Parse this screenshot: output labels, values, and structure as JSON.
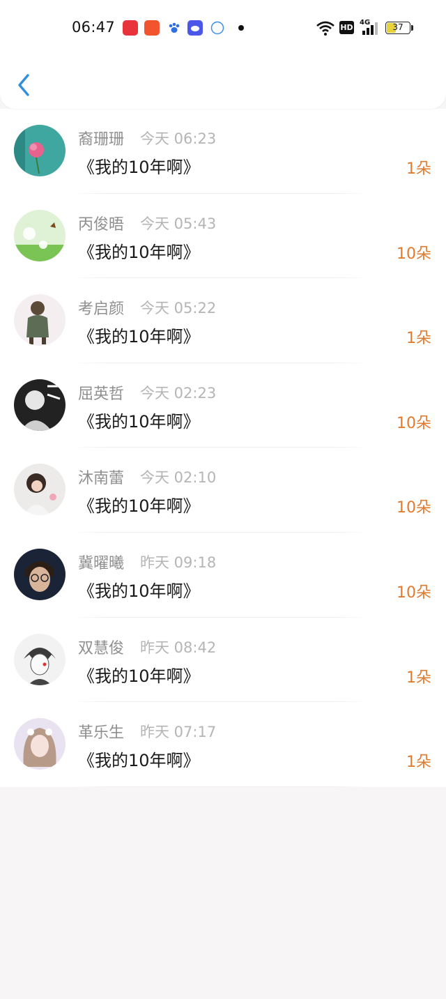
{
  "status_bar": {
    "time": "06:47",
    "hd": "HD",
    "network": "4G",
    "battery": "37"
  },
  "header": {
    "back_icon": "chevron-left-icon",
    "accent_color": "#2f8fdc"
  },
  "colors": {
    "count": "#e27a2e",
    "name": "#8f8f8f",
    "time": "#b5b5b5"
  },
  "items": [
    {
      "name": "裔珊珊",
      "time": "今天 06:23",
      "title": "《我的10年啊》",
      "count": "1朵"
    },
    {
      "name": "丙俊晤",
      "time": "今天 05:43",
      "title": "《我的10年啊》",
      "count": "10朵"
    },
    {
      "name": "考启颜",
      "time": "今天 05:22",
      "title": "《我的10年啊》",
      "count": "1朵"
    },
    {
      "name": "屈英哲",
      "time": "今天 02:23",
      "title": "《我的10年啊》",
      "count": "10朵"
    },
    {
      "name": "沐南蕾",
      "time": "今天 02:10",
      "title": "《我的10年啊》",
      "count": "10朵"
    },
    {
      "name": "冀曜曦",
      "time": "昨天 09:18",
      "title": "《我的10年啊》",
      "count": "10朵"
    },
    {
      "name": "双慧俊",
      "time": "昨天 08:42",
      "title": "《我的10年啊》",
      "count": "1朵"
    },
    {
      "name": "革乐生",
      "time": "昨天 07:17",
      "title": "《我的10年啊》",
      "count": "1朵"
    }
  ]
}
